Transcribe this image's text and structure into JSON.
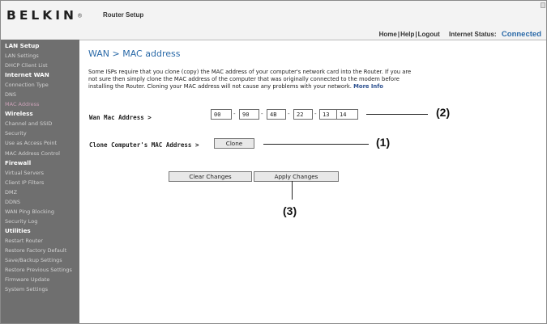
{
  "header": {
    "logo": "BELKIN",
    "logo_mark": "®",
    "page_heading": "Router Setup",
    "links": [
      "Home",
      "Help",
      "Logout"
    ],
    "status_label": "Internet Status:",
    "status_value": "Connected"
  },
  "sidebar": {
    "items": [
      {
        "label": "LAN Setup",
        "section": true
      },
      {
        "label": "LAN Settings"
      },
      {
        "label": "DHCP Client List"
      },
      {
        "label": "Internet WAN",
        "section": true
      },
      {
        "label": "Connection Type"
      },
      {
        "label": "DNS"
      },
      {
        "label": "MAC Address",
        "active": true
      },
      {
        "label": "Wireless",
        "section": true
      },
      {
        "label": "Channel and SSID"
      },
      {
        "label": "Security"
      },
      {
        "label": "Use as Access Point"
      },
      {
        "label": "MAC Address Control"
      },
      {
        "label": "Firewall",
        "section": true
      },
      {
        "label": "Virtual Servers"
      },
      {
        "label": "Client IP Filters"
      },
      {
        "label": "DMZ"
      },
      {
        "label": "DDNS"
      },
      {
        "label": "WAN Ping Blocking"
      },
      {
        "label": "Security Log"
      },
      {
        "label": "Utilities",
        "section": true
      },
      {
        "label": "Restart Router"
      },
      {
        "label": "Restore Factory Default"
      },
      {
        "label": "Save/Backup Settings"
      },
      {
        "label": "Restore Previous Settings"
      },
      {
        "label": "Firmware Update"
      },
      {
        "label": "System Settings"
      }
    ]
  },
  "main": {
    "title": "WAN > MAC address",
    "description": "Some ISPs require that you clone (copy) the MAC address of your computer's network card into the Router. If you are not sure then simply clone the MAC address of the computer that was originally connected to the modem before installing the Router. Cloning your MAC address will not cause any problems with your network.",
    "more_info": "More Info",
    "wan_mac_label": "Wan Mac Address >",
    "wan_mac": [
      "00",
      "90",
      "4B",
      "22",
      "13",
      "14"
    ],
    "mac_separator": "-",
    "clone_label": "Clone Computer's MAC Address >",
    "clone_button": "Clone",
    "clear_button": "Clear Changes",
    "apply_button": "Apply Changes"
  },
  "callouts": {
    "wan_mac": "(2)",
    "clone": "(1)",
    "apply": "(3)"
  }
}
